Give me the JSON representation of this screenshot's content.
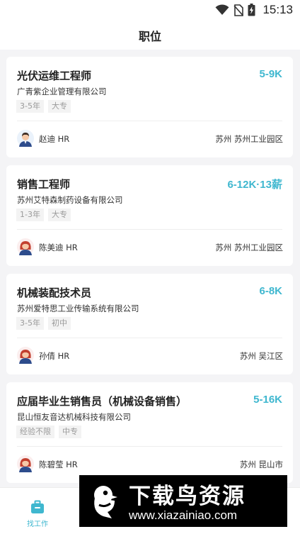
{
  "status_bar": {
    "time": "15:13"
  },
  "header": {
    "title": "职位"
  },
  "jobs": [
    {
      "title": "光伏运维工程师",
      "salary": "5-9K",
      "company": "广青紫企业管理有限公司",
      "tags": [
        "3-5年",
        "大专"
      ],
      "hr": "赵迪 HR",
      "location": "苏州  苏州工业园区"
    },
    {
      "title": "销售工程师",
      "salary": "6-12K·13薪",
      "company": "苏州艾特森制药设备有限公司",
      "tags": [
        "1-3年",
        "大专"
      ],
      "hr": "陈美迪 HR",
      "location": "苏州  苏州工业园区"
    },
    {
      "title": "机械装配技术员",
      "salary": "6-8K",
      "company": "苏州爱特思工业传输系统有限公司",
      "tags": [
        "3-5年",
        "初中"
      ],
      "hr": "孙倩 HR",
      "location": "苏州  吴江区"
    },
    {
      "title": "应届毕业生销售员（机械设备销售）",
      "salary": "5-16K",
      "company": "昆山恒友音达机械科技有限公司",
      "tags": [
        "经验不限",
        "中专"
      ],
      "hr": "陈碧莹 HR",
      "location": "苏州  昆山市"
    }
  ],
  "tab_bar": {
    "tabs": [
      {
        "label": "找工作",
        "icon": "briefcase-icon",
        "active": true
      }
    ]
  },
  "watermark": {
    "title": "下载鸟资源",
    "url": "www.xiazainiao.com"
  },
  "colors": {
    "accent": "#3fb7cf",
    "background": "#f4f4f6"
  }
}
